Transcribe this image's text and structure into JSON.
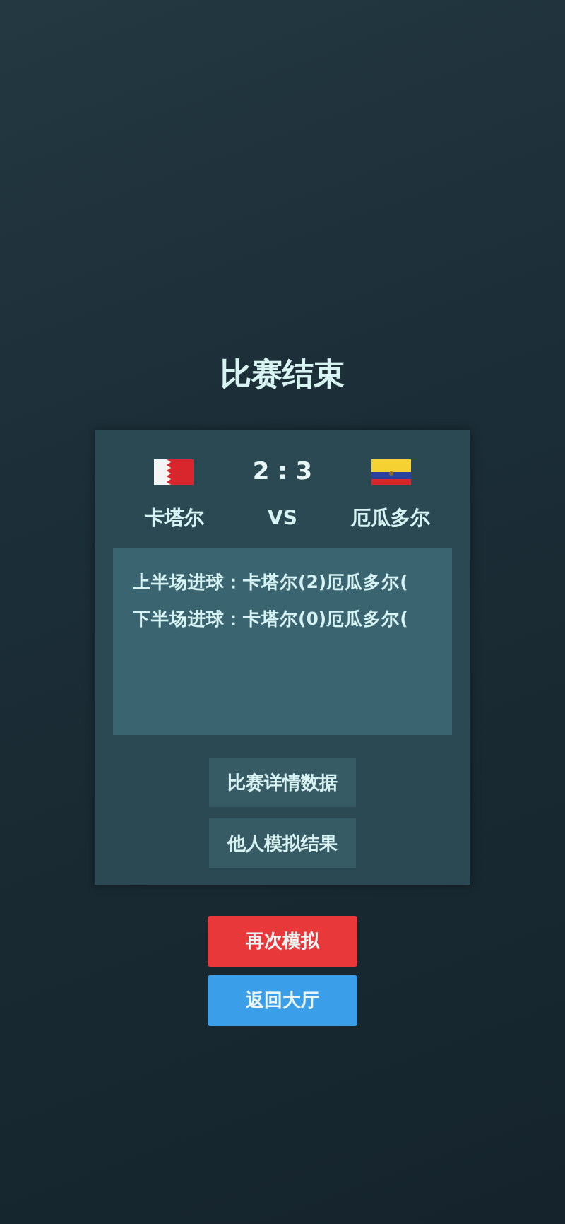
{
  "title": "比赛结束",
  "match": {
    "score": "2 : 3",
    "separator": "VS",
    "teams": [
      {
        "name": "卡塔尔",
        "kind": "serrated"
      },
      {
        "name": "厄瓜多尔",
        "kind": "tricolor"
      }
    ],
    "log": [
      "上半场进球：卡塔尔(2)厄瓜多尔(",
      "下半场进球：卡塔尔(0)厄瓜多尔("
    ],
    "buttons": [
      "比赛详情数据",
      "他人模拟结果"
    ]
  },
  "actions": [
    {
      "label": "再次模拟",
      "kind": "primary"
    },
    {
      "label": "返回大厅",
      "kind": "secondary"
    }
  ]
}
